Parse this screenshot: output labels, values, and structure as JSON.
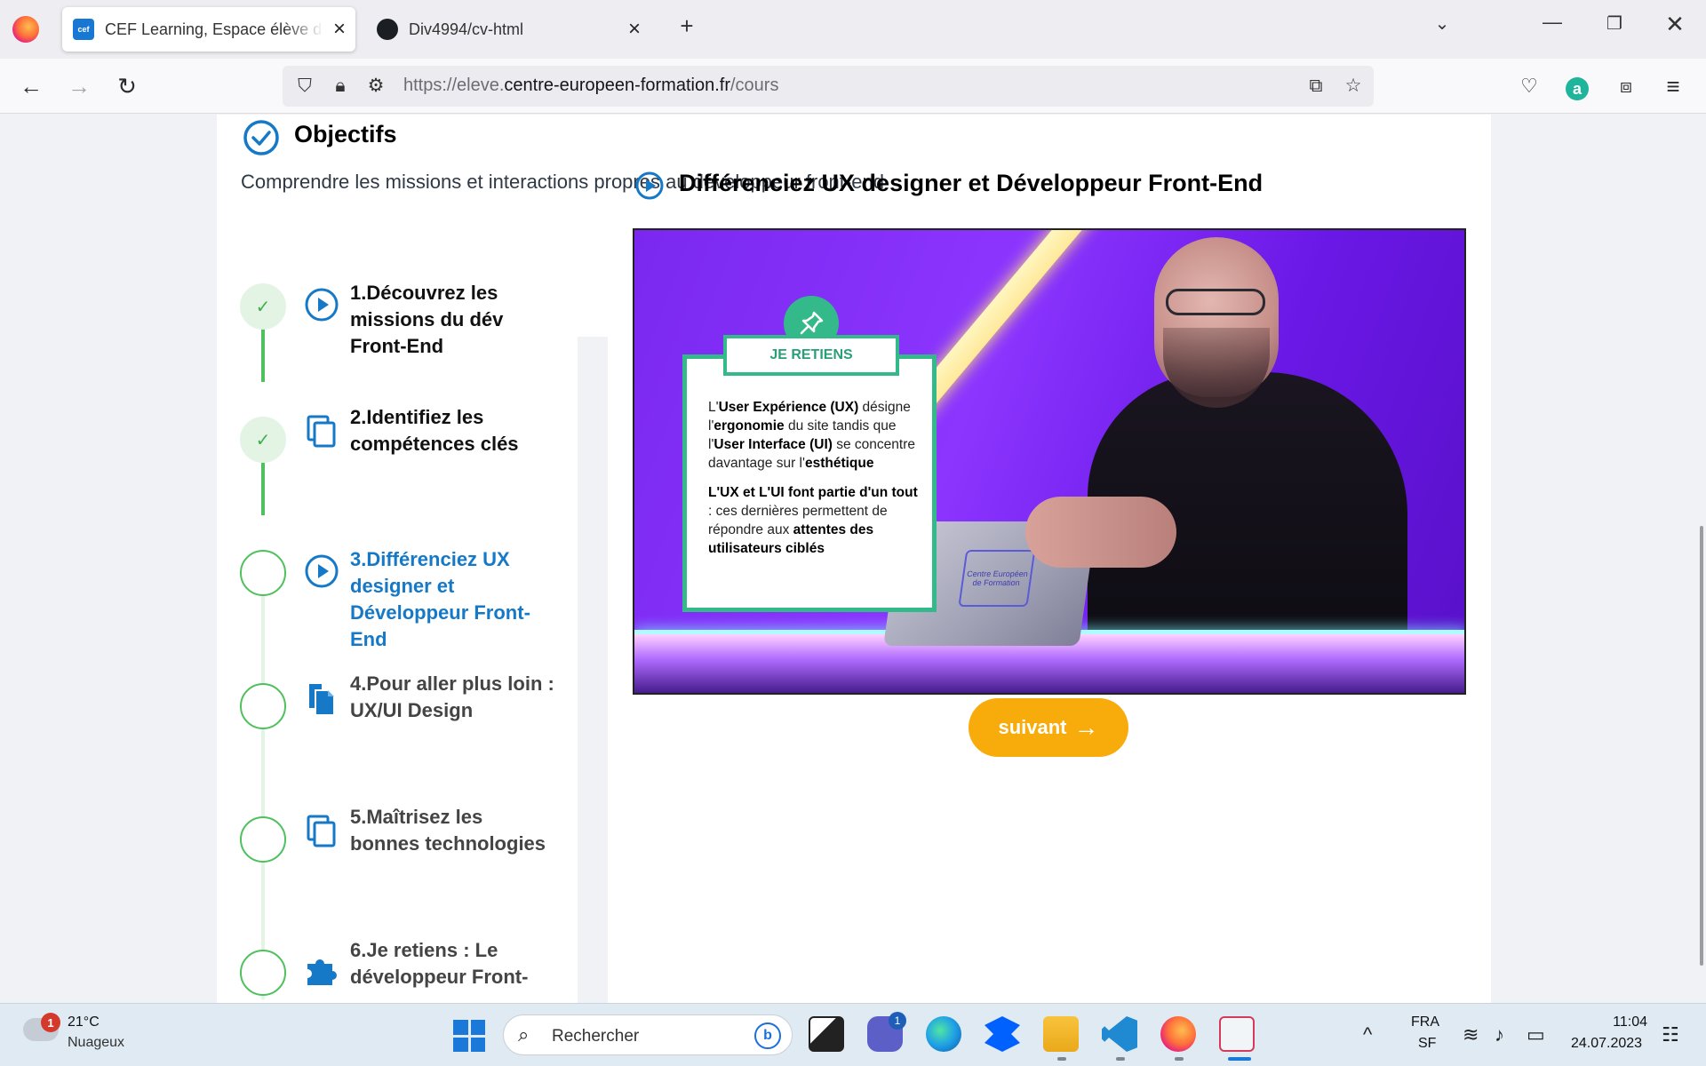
{
  "browser": {
    "tabs": [
      {
        "title": "CEF Learning, Espace élève du Centre",
        "favicon": "cef-logo-icon",
        "active": true
      },
      {
        "title": "Div4994/cv-html",
        "favicon": "github-icon",
        "active": false
      }
    ],
    "url_prefix": "https://eleve.",
    "url_host": "centre-europeen-formation.fr",
    "url_path": "/cours"
  },
  "objectives": {
    "title": "Objectifs",
    "description": "Comprendre les missions et interactions propres au développeur front-end"
  },
  "steps": [
    {
      "label": "1.Découvrez les missions du dév Front-End",
      "status": "done",
      "icon": "play-circle-icon"
    },
    {
      "label": "2.Identifiez les compétences clés",
      "status": "done",
      "icon": "copy-icon"
    },
    {
      "label": "3.Différenciez UX designer et Développeur Front-End",
      "status": "current",
      "icon": "play-circle-icon"
    },
    {
      "label": "4.Pour aller plus loin : UX/UI Design",
      "status": "pending",
      "icon": "file-icon"
    },
    {
      "label": "5.Maîtrisez les bonnes technologies",
      "status": "pending",
      "icon": "copy-icon"
    },
    {
      "label": "6.Je retiens : Le développeur Front-",
      "status": "pending",
      "icon": "puzzle-icon"
    }
  ],
  "content": {
    "title": "Différenciez UX designer et Développeur Front-End",
    "video_overlay": {
      "ribbon": "JE RETIENS",
      "laptop_logo": "Centre Européen de Formation",
      "p1_parts": [
        "L'",
        "User Expérience (UX)",
        " désigne l'",
        "ergonomie",
        " du site tandis que l'",
        "User Interface (UI)",
        " se concentre davantage sur l'",
        "esthétique"
      ],
      "p2_parts": [
        "L'UX et L'UI font partie d'un tout",
        " : ces dernières permettent de répondre aux ",
        "attentes des utilisateurs ciblés"
      ]
    },
    "next_label": "suivant"
  },
  "taskbar": {
    "weather_temp": "21°C",
    "weather_condition": "Nuageux",
    "weather_badge": "1",
    "search_placeholder": "Rechercher",
    "teams_badge": "1",
    "lang_line1": "FRA",
    "lang_line2": "SF",
    "time": "11:04",
    "date": "24.07.2023"
  },
  "colors": {
    "accent_blue": "#1579c7",
    "done_green": "#4ec05d",
    "next_button": "#f7ac0c",
    "overlay_green": "#34b98a"
  }
}
